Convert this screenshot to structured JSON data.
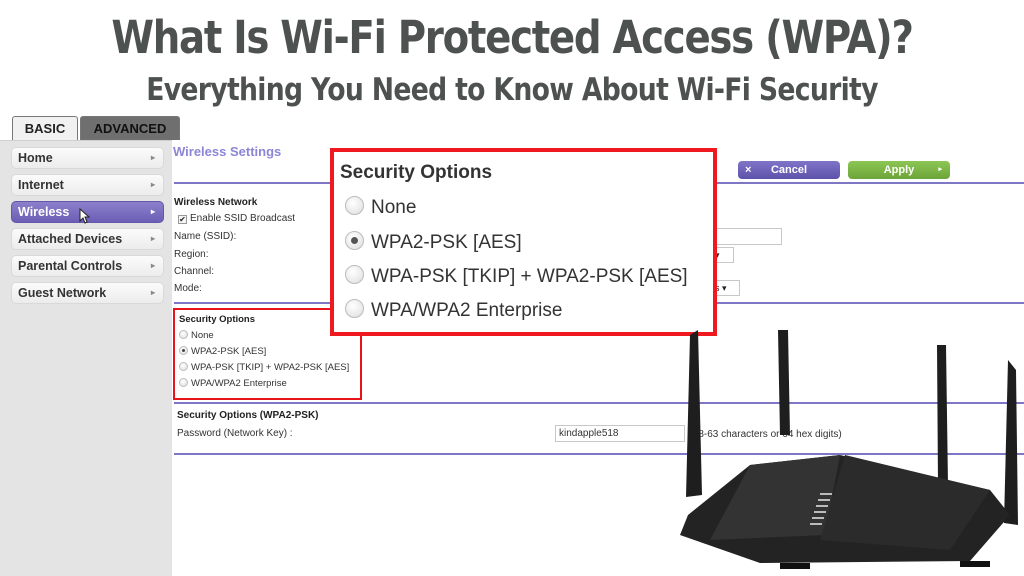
{
  "headline": "What Is Wi-Fi Protected Access (WPA)?",
  "subheadline": "Everything You Need to Know About Wi-Fi Security",
  "tabs": [
    {
      "label": "BASIC",
      "active": true
    },
    {
      "label": "ADVANCED",
      "active": false
    }
  ],
  "sidebar": {
    "items": [
      {
        "label": "Home"
      },
      {
        "label": "Internet"
      },
      {
        "label": "Wireless",
        "active": true
      },
      {
        "label": "Attached Devices"
      },
      {
        "label": "Parental Controls"
      },
      {
        "label": "Guest Network"
      }
    ],
    "arrow": "▸"
  },
  "content": {
    "title": "Wireless Settings",
    "cancel_label": "Cancel",
    "cancel_icon": "×",
    "apply_label": "Apply",
    "apply_icon": "▸",
    "wireless_network": {
      "heading": "Wireless Network",
      "enable_ssid_broadcast": {
        "label": "Enable SSID Broadcast",
        "checked": true
      },
      "name_label": "Name (SSID):",
      "region_label": "Region:",
      "channel_label": "Channel:",
      "mode_label": "Mode:",
      "mode_value_partial": "s"
    },
    "security_options": {
      "heading": "Security Options",
      "options": [
        {
          "label": "None",
          "selected": false
        },
        {
          "label": "WPA2-PSK [AES]",
          "selected": true
        },
        {
          "label": "WPA-PSK [TKIP] + WPA2-PSK [AES]",
          "selected": false
        },
        {
          "label": "WPA/WPA2 Enterprise",
          "selected": false
        }
      ]
    },
    "wpa2_section": {
      "heading": "Security Options (WPA2-PSK)",
      "password_label": "Password (Network Key) :",
      "password_value": "kindapple518",
      "password_hint": "(8-63 characters or 64 hex digits)"
    }
  },
  "colors": {
    "accent_purple": "#7d77c6",
    "highlight_red": "#ee1a1f",
    "apply_green": "#7cb547",
    "headline_gray": "#4d5150"
  }
}
